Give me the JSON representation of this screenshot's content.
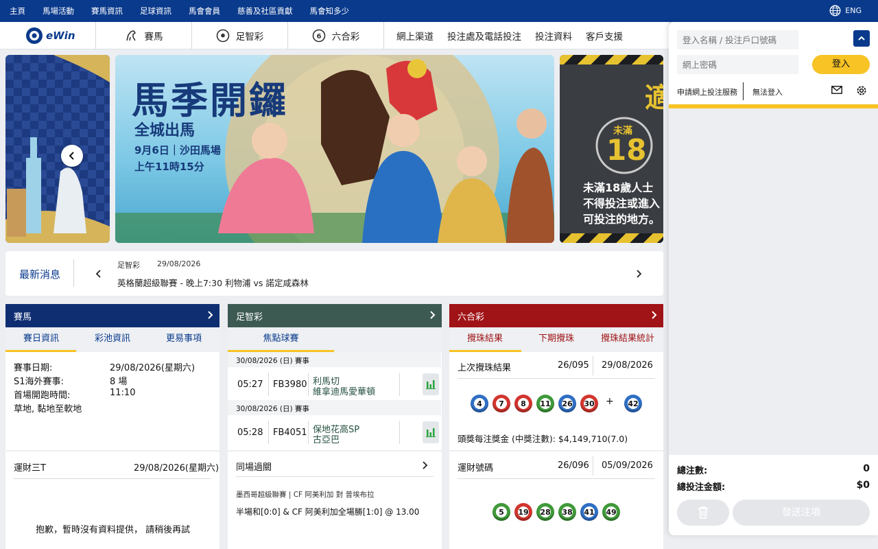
{
  "topbar": {
    "menu": [
      "主頁",
      "馬場活動",
      "賽馬資訊",
      "足球資訊",
      "馬會會員",
      "慈善及社區貢獻",
      "馬會知多少"
    ],
    "lang": "ENG"
  },
  "nav": {
    "logo_text": "eWin",
    "tabs": [
      "賽馬",
      "足智彩",
      "六合彩"
    ],
    "links": [
      "網上渠道",
      "投注處及電話投注",
      "投注資料",
      "客戶支援"
    ]
  },
  "banner": {
    "main_title": "馬季開鑼",
    "main_sub1": "全城出馬",
    "main_sub2": "9月6日｜沙田馬場",
    "main_sub3": "上午11時15分",
    "right_badge_top": "未滿",
    "right_badge_num": "18",
    "right_char": "適",
    "right_lines": [
      "未滿18歲人士",
      "不得投注或進入",
      "可投注的地方。"
    ]
  },
  "news": {
    "label": "最新消息",
    "category": "足智彩",
    "date": "29/08/2026",
    "headline": "英格蘭超級聯賽 - 晚上7:30 利物浦 vs 諾定咸森林"
  },
  "racing": {
    "title": "賽馬",
    "tabs": [
      "賽日資訊",
      "彩池資訊",
      "更易事項"
    ],
    "rows": [
      {
        "k": "賽事日期:",
        "v": "29/08/2026(星期六)"
      },
      {
        "k": "S1海外賽事:",
        "v": "8 場"
      },
      {
        "k": "首場開跑時間:",
        "v": "11:10"
      }
    ],
    "going": "草地, 黏地至軟地",
    "t3_title": "運財三T",
    "t3_date": "29/08/2026(星期六)",
    "t3_msg": "抱歉，暫時沒有資料提供， 請稍後再試"
  },
  "football": {
    "title": "足智彩",
    "tab": "焦點球賽",
    "matches": [
      {
        "day": "30/08/2026 (日) 賽事",
        "time": "05:27",
        "id": "FB3980",
        "home": "利馬切",
        "away": "維拿迪馬愛華頓"
      },
      {
        "day": "30/08/2026 (日) 賽事",
        "time": "05:28",
        "id": "FB4051",
        "home": "保地花高SP",
        "away": "古亞巴"
      }
    ],
    "sgp_title": "同場過關",
    "sgp_league": "墨西哥超級聯賽 | CF 阿美利加 對 普埃布拉",
    "sgp_bet": "半場和[0:0] & CF 阿美利加全場勝[1:0] @ 13.00"
  },
  "marksix": {
    "title": "六合彩",
    "tabs": [
      "攪珠結果",
      "下期攪珠",
      "攪珠結果統計"
    ],
    "last_label": "上次攪珠結果",
    "last_draw": "26/095",
    "last_date": "29/08/2026",
    "balls": [
      {
        "n": "4",
        "c": "blue"
      },
      {
        "n": "7",
        "c": "red"
      },
      {
        "n": "8",
        "c": "red"
      },
      {
        "n": "11",
        "c": "green"
      },
      {
        "n": "26",
        "c": "blue"
      },
      {
        "n": "30",
        "c": "red"
      }
    ],
    "plus": "+",
    "extra": {
      "n": "42",
      "c": "blue"
    },
    "prize": "頭獎每注獎金 (中獎注數): $4,149,710(7.0)",
    "lucky_label": "運財號碼",
    "lucky_draw": "26/096",
    "lucky_date": "05/09/2026",
    "lucky_balls": [
      {
        "n": "5",
        "c": "green"
      },
      {
        "n": "19",
        "c": "red"
      },
      {
        "n": "28",
        "c": "green"
      },
      {
        "n": "38",
        "c": "green"
      },
      {
        "n": "41",
        "c": "blue"
      },
      {
        "n": "49",
        "c": "green"
      }
    ]
  },
  "slip": {
    "login_placeholder": "登入名稱 / 投注戶口號碼",
    "password_placeholder": "網上密碼",
    "login_btn": "登入",
    "apply": "申請網上投注服務",
    "cannot_login": "無法登入",
    "total_bets_label": "總注數:",
    "total_bets": "0",
    "total_amount_label": "總投注金額:",
    "total_amount": "$0",
    "send": "發送注項"
  },
  "colors": {
    "brand": "#0a3a8c",
    "accent": "#f7c325",
    "racing": "#0f2e72",
    "football": "#3d5a52",
    "marksix": "#a01316"
  }
}
